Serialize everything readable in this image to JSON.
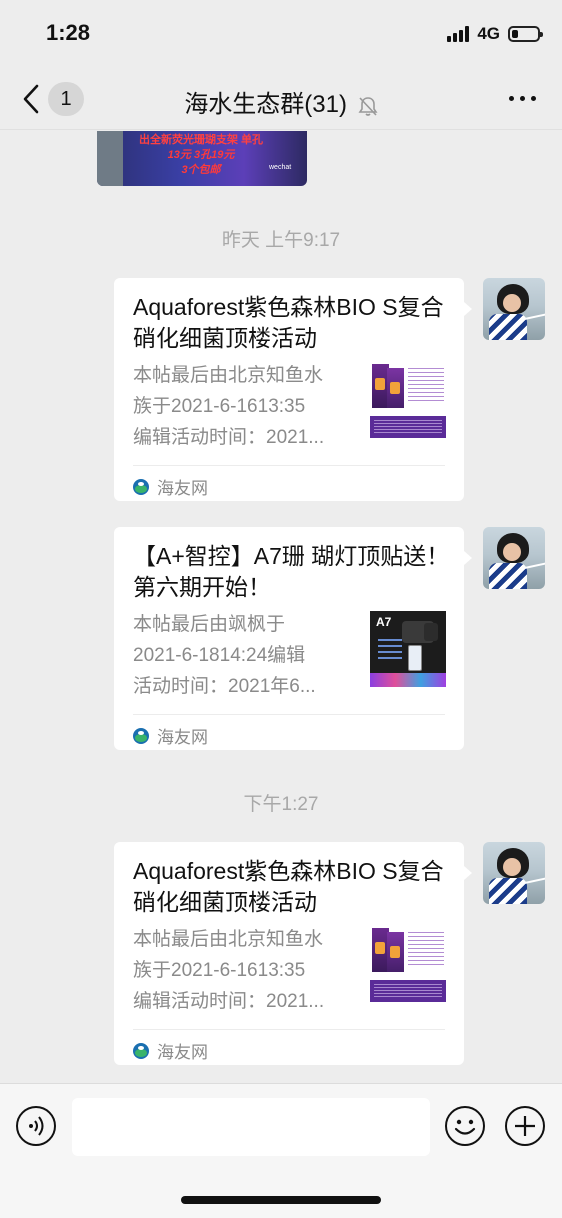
{
  "status": {
    "time": "1:28",
    "network": "4G",
    "battery_level": 0.25
  },
  "nav": {
    "back_count": "1",
    "title": "海水生态群(31)"
  },
  "prev_image": {
    "line1": "出全新荧光珊瑚支架 单孔",
    "line2": "13元  3孔19元",
    "line3": "3个包邮",
    "watermark": "wechat"
  },
  "timestamps": [
    "昨天 上午9:17",
    "下午1:27"
  ],
  "messages": [
    {
      "title": "Aquaforest紫色森林BIO S复合硝化细菌顶楼活动",
      "desc": [
        "本帖最后由北京知鱼水",
        "族于2021-6-1613:35",
        "编辑活动时间：2021..."
      ],
      "source": "海友网",
      "thumb": "aquaforest-product"
    },
    {
      "title": "【A+智控】A7珊 瑚灯顶贴送！第六期开始！",
      "desc": [
        "本帖最后由飒枫于",
        "2021-6-1814:24编辑",
        "活动时间：2021年6..."
      ],
      "source": "海友网",
      "thumb": "a7-lamp",
      "thumb_label": "A7"
    },
    {
      "title": "Aquaforest紫色森林BIO S复合硝化细菌顶楼活动",
      "desc": [
        "本帖最后由北京知鱼水",
        "族于2021-6-1613:35",
        "编辑活动时间：2021..."
      ],
      "source": "海友网",
      "thumb": "aquaforest-product"
    }
  ],
  "input": {
    "value": ""
  },
  "icons": [
    "back-icon",
    "mute-icon",
    "more-icon",
    "voice-icon",
    "emoji-icon",
    "plus-icon"
  ]
}
